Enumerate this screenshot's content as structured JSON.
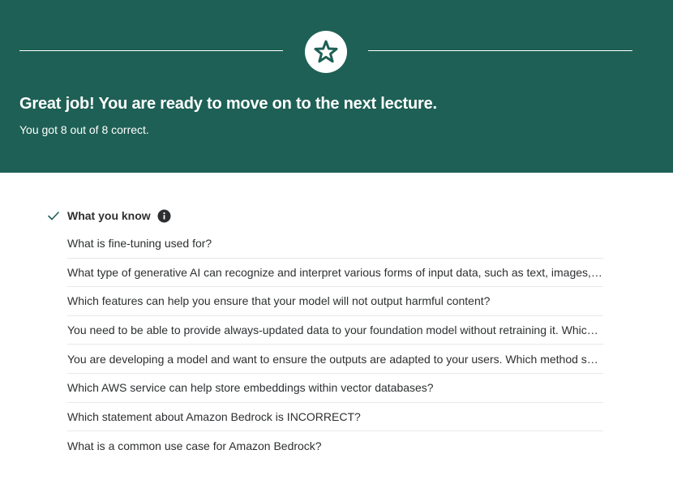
{
  "banner": {
    "background_color": "#1e6055",
    "icon": "star-icon",
    "headline": "Great job! You are ready to move on to the next lecture.",
    "score_text": "You got 8 out of 8 correct."
  },
  "section": {
    "title": "What you know",
    "status_icon": "check-icon",
    "info_icon": "info-icon",
    "accent_color": "#1e6055"
  },
  "questions": [
    "What is fine-tuning used for?",
    "What type of generative AI can recognize and interpret various forms of input data, such as text, images, and audio?",
    "Which features can help you ensure that your model will not output harmful content?",
    "You need to be able to provide always-updated data to your foundation model without retraining it. Which method should you use?",
    "You are developing a model and want to ensure the outputs are adapted to your users. Which method should you use?",
    "Which AWS service can help store embeddings within vector databases?",
    "Which statement about Amazon Bedrock is INCORRECT?",
    "What is a common use case for Amazon Bedrock?"
  ]
}
